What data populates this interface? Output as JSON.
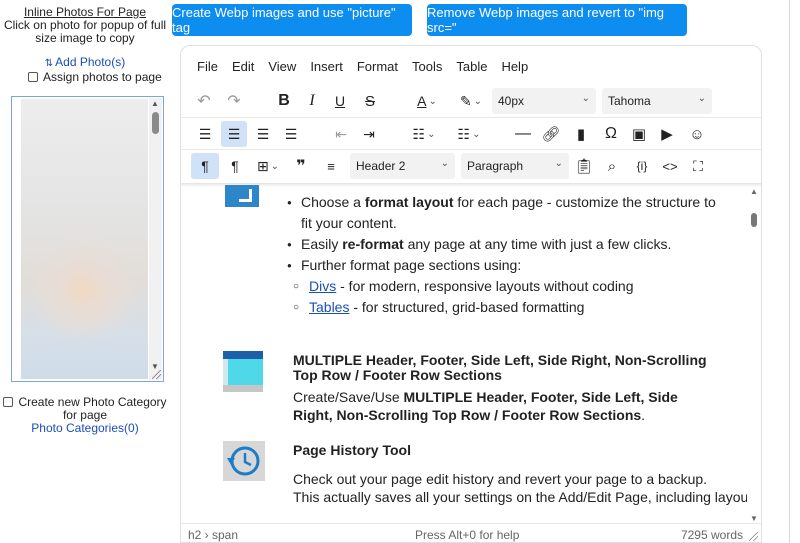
{
  "left_panel": {
    "inline_title": "Inline Photos For Page",
    "inline_desc": "Click on photo for popup of full size image to copy",
    "add_photos": "Add Photo(s)",
    "assign_label": "Assign photos to page",
    "create_category": "Create new Photo Category for page",
    "photo_categories_link": "Photo Categories(0)"
  },
  "buttons": {
    "create_webp": "Create Webp images and use \"picture\" tag",
    "remove_webp": "Remove Webp images and revert to \"img src=\""
  },
  "editor": {
    "menu": [
      "File",
      "Edit",
      "View",
      "Insert",
      "Format",
      "Tools",
      "Table",
      "Help"
    ],
    "font_size": "40px",
    "font_family": "Tahoma",
    "block_format": "Header 2",
    "paragraph_format": "Paragraph",
    "content": {
      "bullet1_pre": "Choose a ",
      "bullet1_bold": "format layout",
      "bullet1_post": " for each page - customize the structure to fit your content.",
      "bullet2_pre": "Easily ",
      "bullet2_bold": "re-format",
      "bullet2_post": " any page at any time with just a few clicks.",
      "bullet3": "Further format page sections using:",
      "sub1_link": "Divs",
      "sub1_text": " - for modern, responsive layouts without coding",
      "sub2_link": "Tables",
      "sub2_text": " - for structured, grid-based formatting",
      "sec1_title": "MULTIPLE Header, Footer, Side Left, Side Right, Non-Scrolling Top Row / Footer Row Sections",
      "sec1_pre": "Create/Save/Use ",
      "sec1_bold": "MULTIPLE Header, Footer, Side Left, Side Right, Non-Scrolling Top Row / Footer Row Sections",
      "sec1_post": ".",
      "sec2_title": "Page History Tool",
      "sec2_text1": "Check out your page edit history and revert your page to a backup.",
      "sec2_text2": "This actually saves all your settings on the Add/Edit Page, including layouts, SEO settings, content, formatting and and"
    },
    "status": {
      "path": "h2 › span",
      "help": "Press Alt+0 for help",
      "words": "7295 words"
    }
  }
}
